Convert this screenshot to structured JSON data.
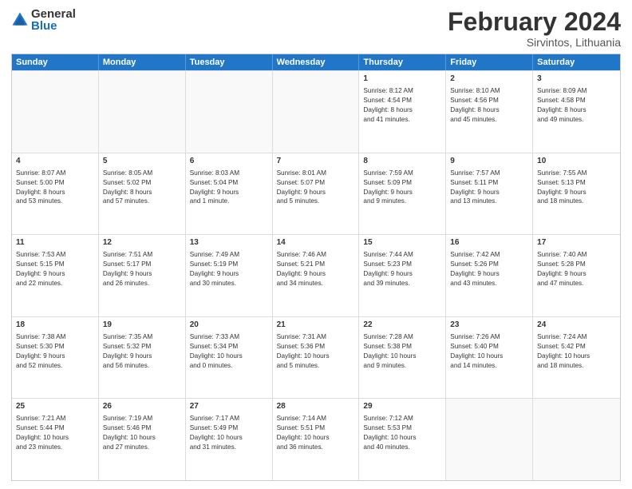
{
  "logo": {
    "general": "General",
    "blue": "Blue"
  },
  "header": {
    "month": "February 2024",
    "location": "Sirvintos, Lithuania"
  },
  "weekdays": [
    "Sunday",
    "Monday",
    "Tuesday",
    "Wednesday",
    "Thursday",
    "Friday",
    "Saturday"
  ],
  "weeks": [
    [
      {
        "day": "",
        "lines": []
      },
      {
        "day": "",
        "lines": []
      },
      {
        "day": "",
        "lines": []
      },
      {
        "day": "",
        "lines": []
      },
      {
        "day": "1",
        "lines": [
          "Sunrise: 8:12 AM",
          "Sunset: 4:54 PM",
          "Daylight: 8 hours",
          "and 41 minutes."
        ]
      },
      {
        "day": "2",
        "lines": [
          "Sunrise: 8:10 AM",
          "Sunset: 4:56 PM",
          "Daylight: 8 hours",
          "and 45 minutes."
        ]
      },
      {
        "day": "3",
        "lines": [
          "Sunrise: 8:09 AM",
          "Sunset: 4:58 PM",
          "Daylight: 8 hours",
          "and 49 minutes."
        ]
      }
    ],
    [
      {
        "day": "4",
        "lines": [
          "Sunrise: 8:07 AM",
          "Sunset: 5:00 PM",
          "Daylight: 8 hours",
          "and 53 minutes."
        ]
      },
      {
        "day": "5",
        "lines": [
          "Sunrise: 8:05 AM",
          "Sunset: 5:02 PM",
          "Daylight: 8 hours",
          "and 57 minutes."
        ]
      },
      {
        "day": "6",
        "lines": [
          "Sunrise: 8:03 AM",
          "Sunset: 5:04 PM",
          "Daylight: 9 hours",
          "and 1 minute."
        ]
      },
      {
        "day": "7",
        "lines": [
          "Sunrise: 8:01 AM",
          "Sunset: 5:07 PM",
          "Daylight: 9 hours",
          "and 5 minutes."
        ]
      },
      {
        "day": "8",
        "lines": [
          "Sunrise: 7:59 AM",
          "Sunset: 5:09 PM",
          "Daylight: 9 hours",
          "and 9 minutes."
        ]
      },
      {
        "day": "9",
        "lines": [
          "Sunrise: 7:57 AM",
          "Sunset: 5:11 PM",
          "Daylight: 9 hours",
          "and 13 minutes."
        ]
      },
      {
        "day": "10",
        "lines": [
          "Sunrise: 7:55 AM",
          "Sunset: 5:13 PM",
          "Daylight: 9 hours",
          "and 18 minutes."
        ]
      }
    ],
    [
      {
        "day": "11",
        "lines": [
          "Sunrise: 7:53 AM",
          "Sunset: 5:15 PM",
          "Daylight: 9 hours",
          "and 22 minutes."
        ]
      },
      {
        "day": "12",
        "lines": [
          "Sunrise: 7:51 AM",
          "Sunset: 5:17 PM",
          "Daylight: 9 hours",
          "and 26 minutes."
        ]
      },
      {
        "day": "13",
        "lines": [
          "Sunrise: 7:49 AM",
          "Sunset: 5:19 PM",
          "Daylight: 9 hours",
          "and 30 minutes."
        ]
      },
      {
        "day": "14",
        "lines": [
          "Sunrise: 7:46 AM",
          "Sunset: 5:21 PM",
          "Daylight: 9 hours",
          "and 34 minutes."
        ]
      },
      {
        "day": "15",
        "lines": [
          "Sunrise: 7:44 AM",
          "Sunset: 5:23 PM",
          "Daylight: 9 hours",
          "and 39 minutes."
        ]
      },
      {
        "day": "16",
        "lines": [
          "Sunrise: 7:42 AM",
          "Sunset: 5:26 PM",
          "Daylight: 9 hours",
          "and 43 minutes."
        ]
      },
      {
        "day": "17",
        "lines": [
          "Sunrise: 7:40 AM",
          "Sunset: 5:28 PM",
          "Daylight: 9 hours",
          "and 47 minutes."
        ]
      }
    ],
    [
      {
        "day": "18",
        "lines": [
          "Sunrise: 7:38 AM",
          "Sunset: 5:30 PM",
          "Daylight: 9 hours",
          "and 52 minutes."
        ]
      },
      {
        "day": "19",
        "lines": [
          "Sunrise: 7:35 AM",
          "Sunset: 5:32 PM",
          "Daylight: 9 hours",
          "and 56 minutes."
        ]
      },
      {
        "day": "20",
        "lines": [
          "Sunrise: 7:33 AM",
          "Sunset: 5:34 PM",
          "Daylight: 10 hours",
          "and 0 minutes."
        ]
      },
      {
        "day": "21",
        "lines": [
          "Sunrise: 7:31 AM",
          "Sunset: 5:36 PM",
          "Daylight: 10 hours",
          "and 5 minutes."
        ]
      },
      {
        "day": "22",
        "lines": [
          "Sunrise: 7:28 AM",
          "Sunset: 5:38 PM",
          "Daylight: 10 hours",
          "and 9 minutes."
        ]
      },
      {
        "day": "23",
        "lines": [
          "Sunrise: 7:26 AM",
          "Sunset: 5:40 PM",
          "Daylight: 10 hours",
          "and 14 minutes."
        ]
      },
      {
        "day": "24",
        "lines": [
          "Sunrise: 7:24 AM",
          "Sunset: 5:42 PM",
          "Daylight: 10 hours",
          "and 18 minutes."
        ]
      }
    ],
    [
      {
        "day": "25",
        "lines": [
          "Sunrise: 7:21 AM",
          "Sunset: 5:44 PM",
          "Daylight: 10 hours",
          "and 23 minutes."
        ]
      },
      {
        "day": "26",
        "lines": [
          "Sunrise: 7:19 AM",
          "Sunset: 5:46 PM",
          "Daylight: 10 hours",
          "and 27 minutes."
        ]
      },
      {
        "day": "27",
        "lines": [
          "Sunrise: 7:17 AM",
          "Sunset: 5:49 PM",
          "Daylight: 10 hours",
          "and 31 minutes."
        ]
      },
      {
        "day": "28",
        "lines": [
          "Sunrise: 7:14 AM",
          "Sunset: 5:51 PM",
          "Daylight: 10 hours",
          "and 36 minutes."
        ]
      },
      {
        "day": "29",
        "lines": [
          "Sunrise: 7:12 AM",
          "Sunset: 5:53 PM",
          "Daylight: 10 hours",
          "and 40 minutes."
        ]
      },
      {
        "day": "",
        "lines": []
      },
      {
        "day": "",
        "lines": []
      }
    ]
  ]
}
